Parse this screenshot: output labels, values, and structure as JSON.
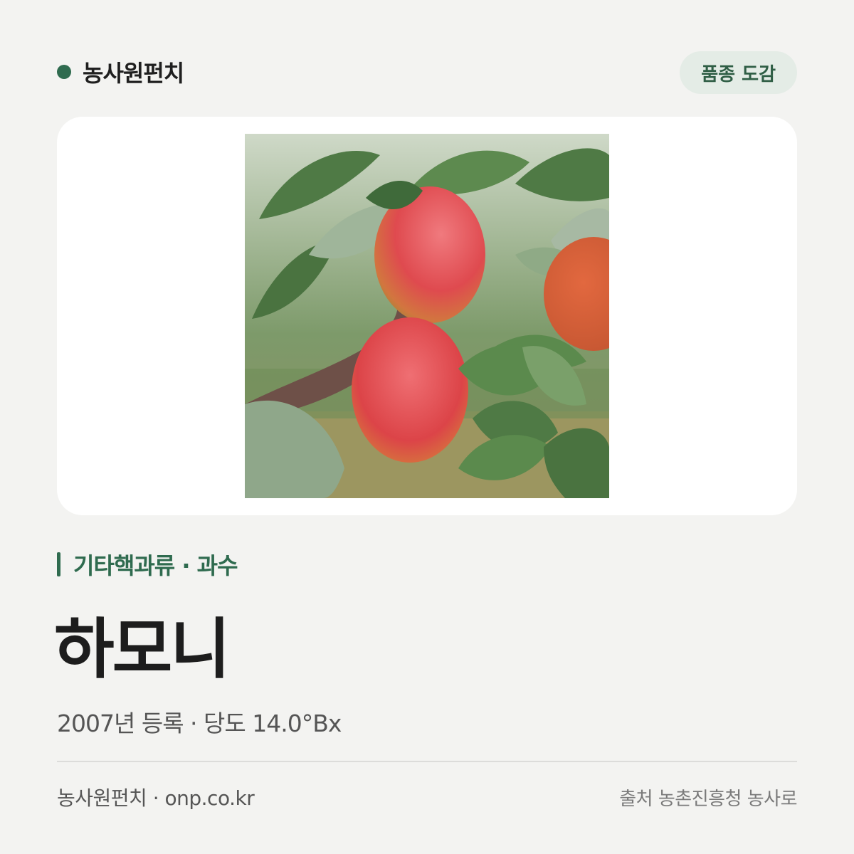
{
  "header": {
    "brand_name": "농사원펀치",
    "badge_label": "품종 도감"
  },
  "photo": {
    "alt": "하모니"
  },
  "variety": {
    "category": "기타핵과류 · 과수",
    "name": "하모니",
    "meta": "2007년 등록 · 당도 14.0°Bx"
  },
  "footer": {
    "left": "농사원펀치 · onp.co.kr",
    "right": "출처 농촌진흥청 농사로"
  },
  "colors": {
    "accent": "#2f6b4f",
    "background": "#f3f3f1",
    "badge_bg": "#e4ece6"
  }
}
